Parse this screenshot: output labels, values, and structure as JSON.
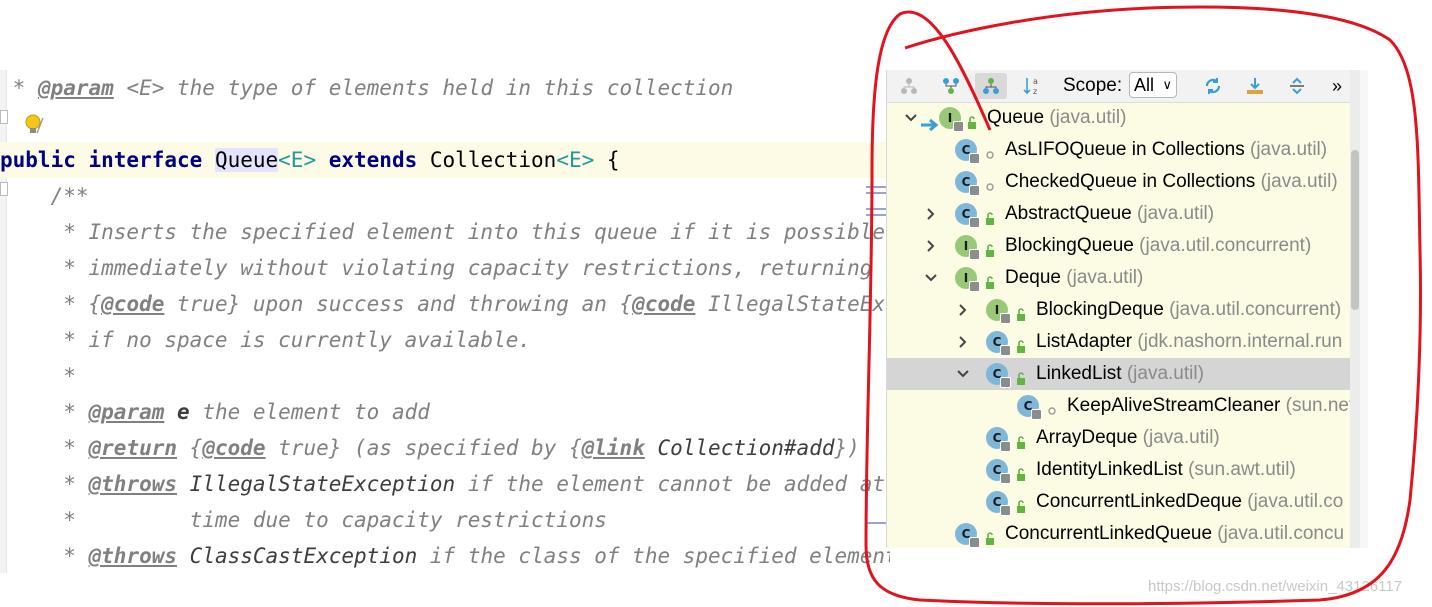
{
  "editor": {
    "lines": [
      " * @param <E> the type of elements held in this collection",
      "",
      "public interface Queue<E> extends Collection<E> {",
      "    /**",
      "     * Inserts the specified element into this queue if it is possible to do so",
      "     * immediately without violating capacity restrictions, returning",
      "     * {@code true} upon success and throwing an {@code IllegalStateException}",
      "     * if no space is currently available.",
      "     *",
      "     * @param e the element to add",
      "     * @return {@code true} (as specified by {@link Collection#add})",
      "     * @throws IllegalStateException if the element cannot be added at this",
      "     *         time due to capacity restrictions",
      "     * @throws ClassCastException if the class of the specified element"
    ],
    "l0": {
      "star": " * ",
      "tag": "@param",
      "p": " <E>",
      "rest": " the type of elements held in this collection"
    },
    "l2": {
      "kw1": "public interface ",
      "name": "Queue",
      "tp1": "<E>",
      "kw2": " extends ",
      "coll": "Collection",
      "tp2": "<E>",
      "brace": " {"
    },
    "l3": "    /**",
    "l4": "     * Inserts the specified element into this queue if it is possible to do so",
    "l5": "     * immediately without violating capacity restrictions, returning",
    "l6": {
      "a": "     * {",
      "t1": "@code",
      "b": " true} upon success and throwing an {",
      "t2": "@code",
      "c": " IllegalStateException}"
    },
    "l7": "     * if no space is currently available.",
    "l8": "     *",
    "l9": {
      "a": "     * ",
      "t": "@param",
      "p": " e",
      "b": " the element to add"
    },
    "l10": {
      "a": "     * ",
      "t1": "@return",
      "b": " {",
      "t2": "@code",
      "c": " true} (as specified by {",
      "t3": "@link",
      "d": " Collection#add",
      "e": "})"
    },
    "l11": {
      "a": "     * ",
      "t": "@throws",
      "ex": " IllegalStateException",
      "b": " if the element cannot be added at this"
    },
    "l12": "     *         time due to capacity restrictions",
    "l13": {
      "a": "     * ",
      "t": "@throws",
      "ex": " ClassCastException",
      "b": " if the class of the specified element"
    }
  },
  "popup": {
    "scope_label": "Scope:",
    "scope_value": "All",
    "more_label": "»",
    "rows": [
      {
        "name": "Queue",
        "pkg": " (java.util)",
        "kind": "I",
        "arrow": "down"
      },
      {
        "name": "AsLIFOQueue in Collections",
        "pkg": " (java.util)",
        "kind": "C",
        "arrow": ""
      },
      {
        "name": "CheckedQueue in Collections",
        "pkg": " (java.util)",
        "kind": "C",
        "arrow": ""
      },
      {
        "name": "AbstractQueue",
        "pkg": " (java.util)",
        "kind": "C",
        "arrow": "right"
      },
      {
        "name": "BlockingQueue",
        "pkg": " (java.util.concurrent)",
        "kind": "I",
        "arrow": "right"
      },
      {
        "name": "Deque",
        "pkg": " (java.util)",
        "kind": "I",
        "arrow": "down"
      },
      {
        "name": "BlockingDeque",
        "pkg": " (java.util.concurrent)",
        "kind": "I",
        "arrow": "right"
      },
      {
        "name": "ListAdapter",
        "pkg": " (jdk.nashorn.internal.run",
        "kind": "C",
        "arrow": "right"
      },
      {
        "name": "LinkedList",
        "pkg": " (java.util)",
        "kind": "C",
        "arrow": "down"
      },
      {
        "name": "KeepAliveStreamCleaner",
        "pkg": " (sun.net",
        "kind": "C",
        "arrow": ""
      },
      {
        "name": "ArrayDeque",
        "pkg": " (java.util)",
        "kind": "C",
        "arrow": ""
      },
      {
        "name": "IdentityLinkedList",
        "pkg": " (sun.awt.util)",
        "kind": "C",
        "arrow": ""
      },
      {
        "name": "ConcurrentLinkedDeque",
        "pkg": " (java.util.co",
        "kind": "C",
        "arrow": ""
      },
      {
        "name": "ConcurrentLinkedQueue",
        "pkg": " (java.util.concu",
        "kind": "C",
        "arrow": ""
      }
    ],
    "selected_row": "LinkedList"
  },
  "watermark": "https://blog.csdn.net/weixin_43126117",
  "colors": {
    "annotation": "#e0141e",
    "popup_bg": "#fcfbe3",
    "keyword": "#000080"
  }
}
